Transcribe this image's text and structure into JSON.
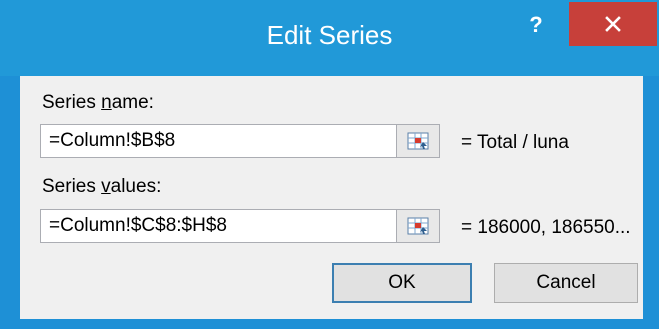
{
  "dialog": {
    "title": "Edit Series",
    "help_label": "?",
    "close_icon": "close-icon"
  },
  "series_name": {
    "label_prefix": "Series ",
    "label_accel": "n",
    "label_suffix": "ame:",
    "value": "=Column!$B$8",
    "preview": "= Total / luna",
    "ref_icon": "range-select-icon"
  },
  "series_values": {
    "label_prefix": "Series ",
    "label_accel": "v",
    "label_suffix": "alues:",
    "value": "=Column!$C$8:$H$8",
    "preview": "= 186000, 186550...",
    "ref_icon": "range-select-icon"
  },
  "buttons": {
    "ok": "OK",
    "cancel": "Cancel"
  },
  "colors": {
    "title_bar": "#2199d8",
    "close_button": "#c7403a",
    "dialog_body": "#f0f0f0"
  }
}
